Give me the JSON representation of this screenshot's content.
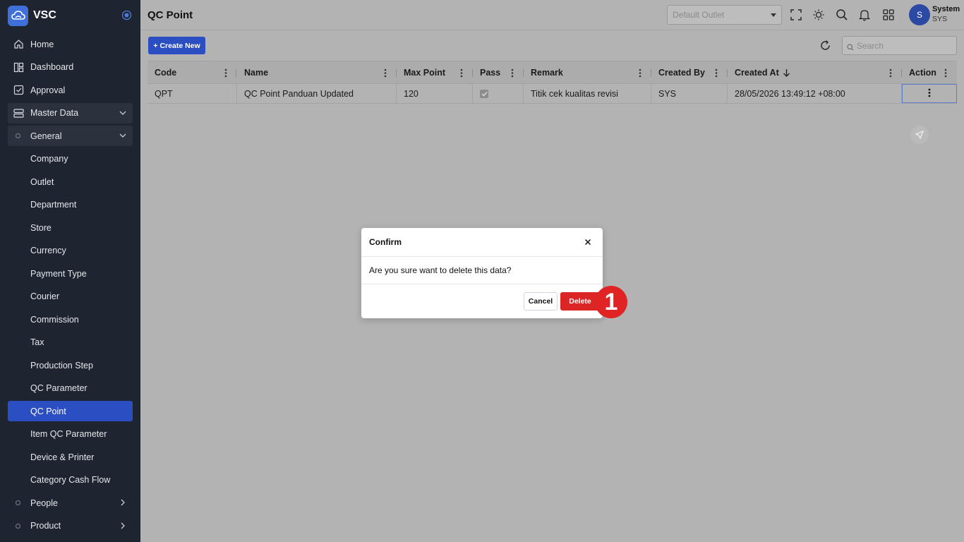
{
  "app": {
    "name": "VSC"
  },
  "sidebar": {
    "items": [
      {
        "label": "Home",
        "icon": "home-icon"
      },
      {
        "label": "Dashboard",
        "icon": "dashboard-icon"
      },
      {
        "label": "Approval",
        "icon": "approval-icon"
      },
      {
        "label": "Master Data",
        "icon": "database-icon",
        "expanded": true
      },
      {
        "label": "General",
        "icon": "circle-icon",
        "expanded": true
      },
      {
        "label": "Company"
      },
      {
        "label": "Outlet"
      },
      {
        "label": "Department"
      },
      {
        "label": "Store"
      },
      {
        "label": "Currency"
      },
      {
        "label": "Payment Type"
      },
      {
        "label": "Courier"
      },
      {
        "label": "Commission"
      },
      {
        "label": "Tax"
      },
      {
        "label": "Production Step"
      },
      {
        "label": "QC Parameter"
      },
      {
        "label": "QC Point",
        "active": true
      },
      {
        "label": "Item QC Parameter"
      },
      {
        "label": "Device & Printer"
      },
      {
        "label": "Category Cash Flow"
      },
      {
        "label": "People",
        "icon": "circle-icon"
      },
      {
        "label": "Product",
        "icon": "circle-icon"
      }
    ]
  },
  "header": {
    "title": "QC Point",
    "outlet_placeholder": "Default Outlet",
    "user_name": "System",
    "user_code": "SYS",
    "avatar_initial": "S"
  },
  "toolbar": {
    "create_label": "Create New",
    "search_placeholder": "Search"
  },
  "table": {
    "columns": [
      "Code",
      "Name",
      "Max Point",
      "Pass",
      "Remark",
      "Created By",
      "Created At",
      "Action"
    ],
    "sorted_column": "Created At",
    "sort_direction": "descending",
    "rows": [
      {
        "code": "QPT",
        "name": "QC Point Panduan Updated",
        "max_point": "120",
        "pass": true,
        "remark": "Titik cek kualitas revisi",
        "created_by": "SYS",
        "created_at": "28/05/2026 13:49:12 +08:00"
      }
    ]
  },
  "modal": {
    "title": "Confirm",
    "message": "Are you sure want to delete this data?",
    "cancel_label": "Cancel",
    "delete_label": "Delete"
  },
  "annotation": {
    "step": "1"
  },
  "colors": {
    "primary": "#2b4ec2",
    "danger": "#dc2626",
    "sidebar_bg": "#1e2430"
  }
}
